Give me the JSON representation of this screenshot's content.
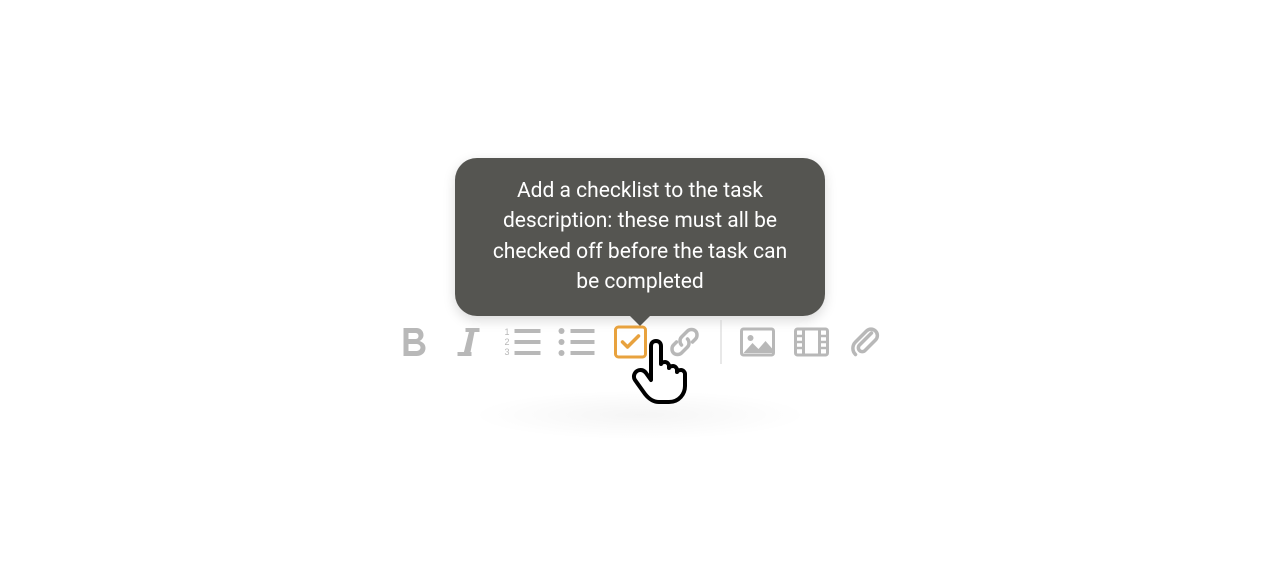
{
  "tooltip": {
    "text": "Add a checklist to the task description: these must all be checked off before the task can be completed"
  },
  "toolbar": {
    "bold": "Bold",
    "italic": "Italic",
    "ordered_list": "Ordered List",
    "unordered_list": "Unordered List",
    "checklist": "Checklist",
    "link": "Link",
    "image": "Image",
    "video": "Video",
    "attachment": "Attachment"
  },
  "colors": {
    "active": "#e8a23e",
    "inactive": "#b8b8b8",
    "tooltip_bg": "#555551"
  }
}
